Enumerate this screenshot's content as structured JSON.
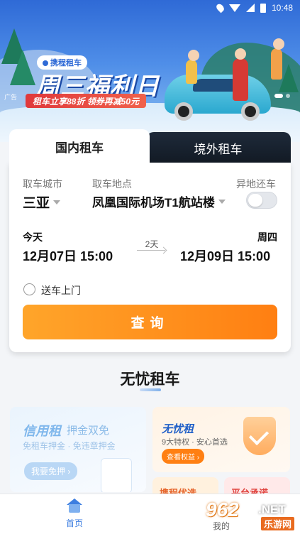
{
  "status_bar": {
    "time": "10:48"
  },
  "banner": {
    "brand": "携程租车",
    "headline": "周三福利日",
    "promo": "租车立享88折 领券再减50元",
    "ad_tag": "广告"
  },
  "tabs": [
    {
      "label": "国内租车",
      "active": true
    },
    {
      "label": "境外租车",
      "active": false
    }
  ],
  "form": {
    "city_label": "取车城市",
    "city_value": "三亚",
    "location_label": "取车地点",
    "location_value": "凤凰国际机场T1航站楼",
    "return_diff_label": "异地还车",
    "return_diff_on": false,
    "pickup_day": "今天",
    "pickup_datetime": "12月07日 15:00",
    "duration": "2天",
    "return_day": "周四",
    "return_datetime": "12月09日 15:00",
    "delivery_label": "送车上门",
    "delivery_checked": false,
    "query_button": "查询"
  },
  "section": {
    "title": "无忧租车",
    "credit": {
      "title": "信用租",
      "subtitle": "押金双免",
      "desc": "免租车押金 · 免违章押金",
      "button": "我要免押 ›"
    },
    "worry_free": {
      "title": "无忧租",
      "desc": "9大特权 · 安心首选",
      "button": "查看权益 ›"
    },
    "recommend": "携程优选",
    "promise": "平台承诺"
  },
  "bottom_nav": {
    "home": "首页",
    "mine": "我的"
  },
  "watermark": {
    "number": "962",
    "domain": ".NET",
    "cn": "乐游网"
  },
  "colors": {
    "accent_orange": "#ff8a1a",
    "brand_blue": "#3d7ee0",
    "tab_dark": "#1a2430"
  }
}
